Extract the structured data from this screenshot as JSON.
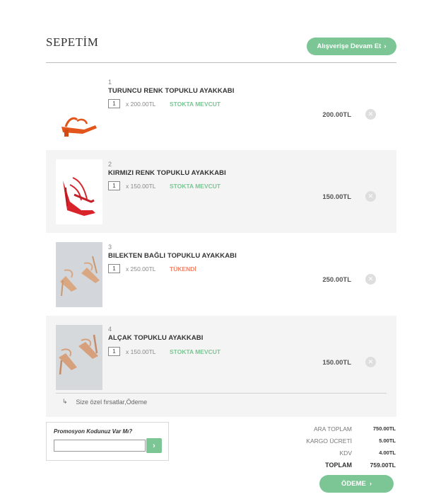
{
  "header": {
    "title": "SEPETİM",
    "continue_label": "Alışverişe Devam Et",
    "continue_icon": "chevron-right-icon"
  },
  "items": [
    {
      "number": "1",
      "name": "TURUNCU RENK TOPUKLU AYAKKABI",
      "qty": "1",
      "unit_price": "x 200.00TL",
      "stock": "STOKTA MEVCUT",
      "stock_color": "#7cc594",
      "total": "200.00TL",
      "image": "orange-heeled-sandal"
    },
    {
      "number": "2",
      "name": "KIRMIZI RENK TOPUKLU AYAKKABI",
      "qty": "1",
      "unit_price": "x 150.00TL",
      "stock": "STOKTA MEVCUT",
      "stock_color": "#7cc594",
      "total": "150.00TL",
      "image": "red-strappy-heel"
    },
    {
      "number": "3",
      "name": "BILEKTEN BAĞLI TOPUKLU AYAKKABI",
      "qty": "1",
      "unit_price": "x 250.00TL",
      "stock": "TÜKENDİ",
      "stock_color": "#f0856b",
      "total": "250.00TL",
      "image": "nude-ankle-strap-heel"
    },
    {
      "number": "4",
      "name": "ALÇAK TOPUKLU AYAKKABI",
      "qty": "1",
      "unit_price": "x 150.00TL",
      "stock": "STOKTA MEVCUT",
      "stock_color": "#7cc594",
      "total": "150.00TL",
      "image": "nude-low-heel"
    }
  ],
  "opportunities": {
    "icon": "return-arrow-icon",
    "label": "Size özel fırsatlar,Ödeme"
  },
  "promo": {
    "label": "Promosyon Kodunuz Var Mı?",
    "placeholder": "",
    "submit_icon": "chevron-right-icon"
  },
  "summary": {
    "subtotal_label": "ARA TOPLAM",
    "subtotal": "750.00TL",
    "shipping_label": "KARGO ÜCRETİ",
    "shipping": "5.00TL",
    "tax_label": "KDV",
    "tax": "4.00TL",
    "grand_label": "TOPLAM",
    "grand": "759.00TL"
  },
  "pay_label": "ÖDEME",
  "colors": {
    "accent": "#7cc594",
    "out_of_stock": "#f0856b",
    "row_shade": "#f4f4f4"
  }
}
